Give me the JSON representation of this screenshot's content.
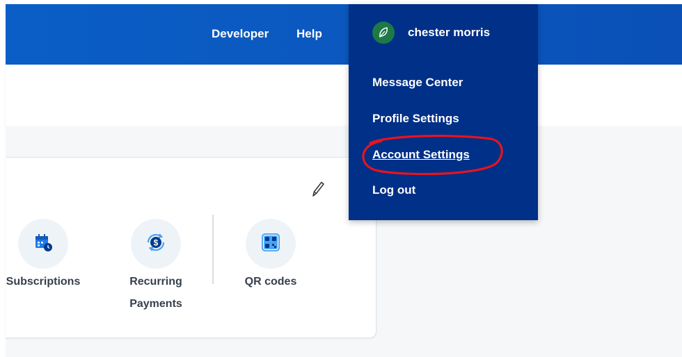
{
  "header": {
    "links": [
      {
        "label": "Developer"
      },
      {
        "label": "Help"
      }
    ]
  },
  "user_menu": {
    "user_name": "chester morris",
    "avatar_icon": "leaf-avatar-icon",
    "items": [
      {
        "label": "Message Center",
        "active": false
      },
      {
        "label": "Profile Settings",
        "active": false
      },
      {
        "label": "Account Settings",
        "active": true
      },
      {
        "label": "Log out",
        "active": false
      }
    ],
    "bg_color": "#003087"
  },
  "quick_actions": {
    "edit_icon": "pencil-icon",
    "tiles": [
      {
        "label": "Subscriptions",
        "icon": "calendar-clock-icon"
      },
      {
        "label": "Recurring Payments",
        "icon": "dollar-cycle-icon"
      },
      {
        "label": "QR codes",
        "icon": "qr-code-icon"
      }
    ]
  },
  "annotation": {
    "type": "red-circle",
    "target": "Account Settings",
    "color": "#e8141c"
  },
  "colors": {
    "header_blue": "#0a5ec6",
    "menu_navy": "#003087",
    "icon_blue": "#1f7be8"
  }
}
